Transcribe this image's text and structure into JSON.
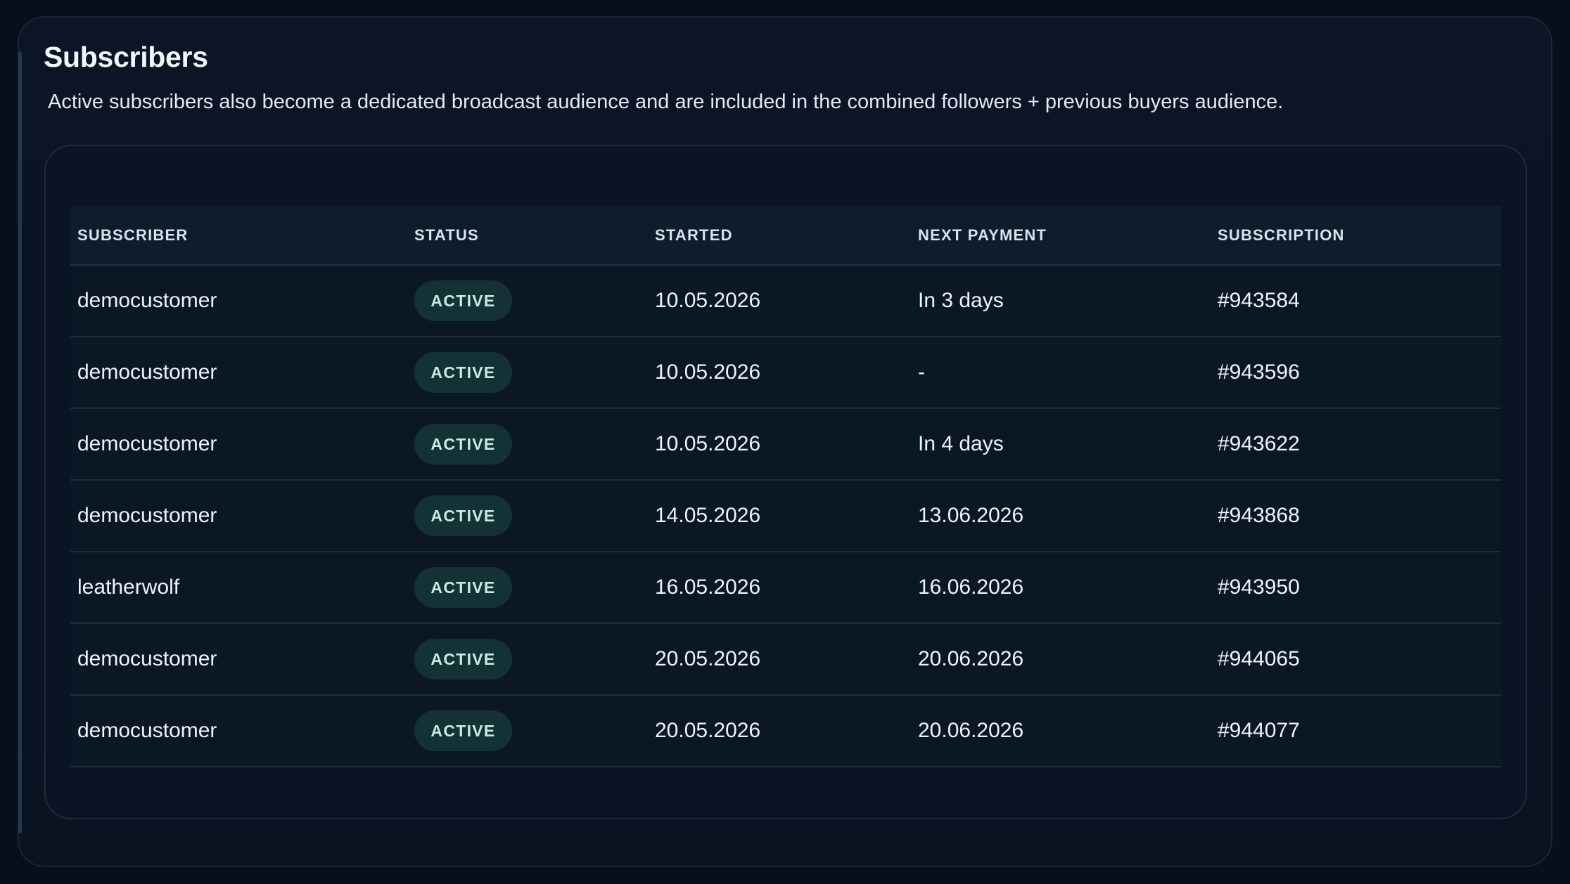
{
  "header": {
    "title": "Subscribers",
    "description": "Active subscribers also become a dedicated broadcast audience and are included in the combined followers + previous buyers audience."
  },
  "table": {
    "columns": [
      "SUBSCRIBER",
      "STATUS",
      "STARTED",
      "NEXT PAYMENT",
      "SUBSCRIPTION"
    ],
    "rows": [
      {
        "subscriber": "democustomer",
        "status": "ACTIVE",
        "started": "10.05.2026",
        "next_payment": "In 3 days",
        "subscription": "#943584"
      },
      {
        "subscriber": "democustomer",
        "status": "ACTIVE",
        "started": "10.05.2026",
        "next_payment": "-",
        "subscription": "#943596"
      },
      {
        "subscriber": "democustomer",
        "status": "ACTIVE",
        "started": "10.05.2026",
        "next_payment": "In 4 days",
        "subscription": "#943622"
      },
      {
        "subscriber": "democustomer",
        "status": "ACTIVE",
        "started": "14.05.2026",
        "next_payment": "13.06.2026",
        "subscription": "#943868"
      },
      {
        "subscriber": "leatherwolf",
        "status": "ACTIVE",
        "started": "16.05.2026",
        "next_payment": "16.06.2026",
        "subscription": "#943950"
      },
      {
        "subscriber": "democustomer",
        "status": "ACTIVE",
        "started": "20.05.2026",
        "next_payment": "20.06.2026",
        "subscription": "#944065"
      },
      {
        "subscriber": "democustomer",
        "status": "ACTIVE",
        "started": "20.05.2026",
        "next_payment": "20.06.2026",
        "subscription": "#944077"
      }
    ]
  },
  "colors": {
    "background": "#070e1c",
    "panel": "#0b1526",
    "badge_bg": "#143236",
    "badge_text": "#c9e8e2"
  }
}
